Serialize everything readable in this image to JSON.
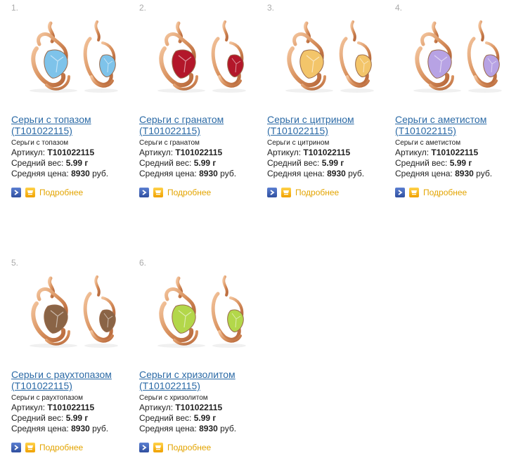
{
  "labels": {
    "sku": "Артикул:",
    "weight": "Средний вес:",
    "price": "Средняя цена:",
    "more": "Подробнее"
  },
  "icons": {
    "arrow": "arrow-right-icon",
    "cart": "cart-icon"
  },
  "colors": {
    "link": "#2b6aa6",
    "more": "#e3a400",
    "number": "#aaaaaa",
    "gold": "#d9925f"
  },
  "products": [
    {
      "number": "1.",
      "title_line1": "Серьги с топазом",
      "title_line2": "(T101022115)",
      "subtitle": "Серьги с топазом",
      "sku": "T101022115",
      "weight": "5.99 г",
      "price": "8930",
      "currency": "руб.",
      "stone_color": "#7ec3ea"
    },
    {
      "number": "2.",
      "title_line1": "Серьги с гранатом",
      "title_line2": "(T101022115)",
      "subtitle": "Серьги с гранатом",
      "sku": "T101022115",
      "weight": "5.99 г",
      "price": "8930",
      "currency": "руб.",
      "stone_color": "#b3172a"
    },
    {
      "number": "3.",
      "title_line1": "Серьги с цитрином",
      "title_line2": "(T101022115)",
      "subtitle": "Серьги с цитрином",
      "sku": "T101022115",
      "weight": "5.99 г",
      "price": "8930",
      "currency": "руб.",
      "stone_color": "#f3c56a"
    },
    {
      "number": "4.",
      "title_line1": "Серьги с аметистом",
      "title_line2": "(T101022115)",
      "subtitle": "Серьги с аметистом",
      "sku": "T101022115",
      "weight": "5.99 г",
      "price": "8930",
      "currency": "руб.",
      "stone_color": "#b7a2e4"
    },
    {
      "number": "5.",
      "title_line1": "Серьги с раухтопазом",
      "title_line2": "(T101022115)",
      "subtitle": "Серьги с раухтопазом",
      "sku": "T101022115",
      "weight": "5.99 г",
      "price": "8930",
      "currency": "руб.",
      "stone_color": "#8a6446"
    },
    {
      "number": "6.",
      "title_line1": "Серьги с хризолитом",
      "title_line2": "(T101022115)",
      "subtitle": "Серьги с хризолитом",
      "sku": "T101022115",
      "weight": "5.99 г",
      "price": "8930",
      "currency": "руб.",
      "stone_color": "#b3d74a"
    }
  ]
}
